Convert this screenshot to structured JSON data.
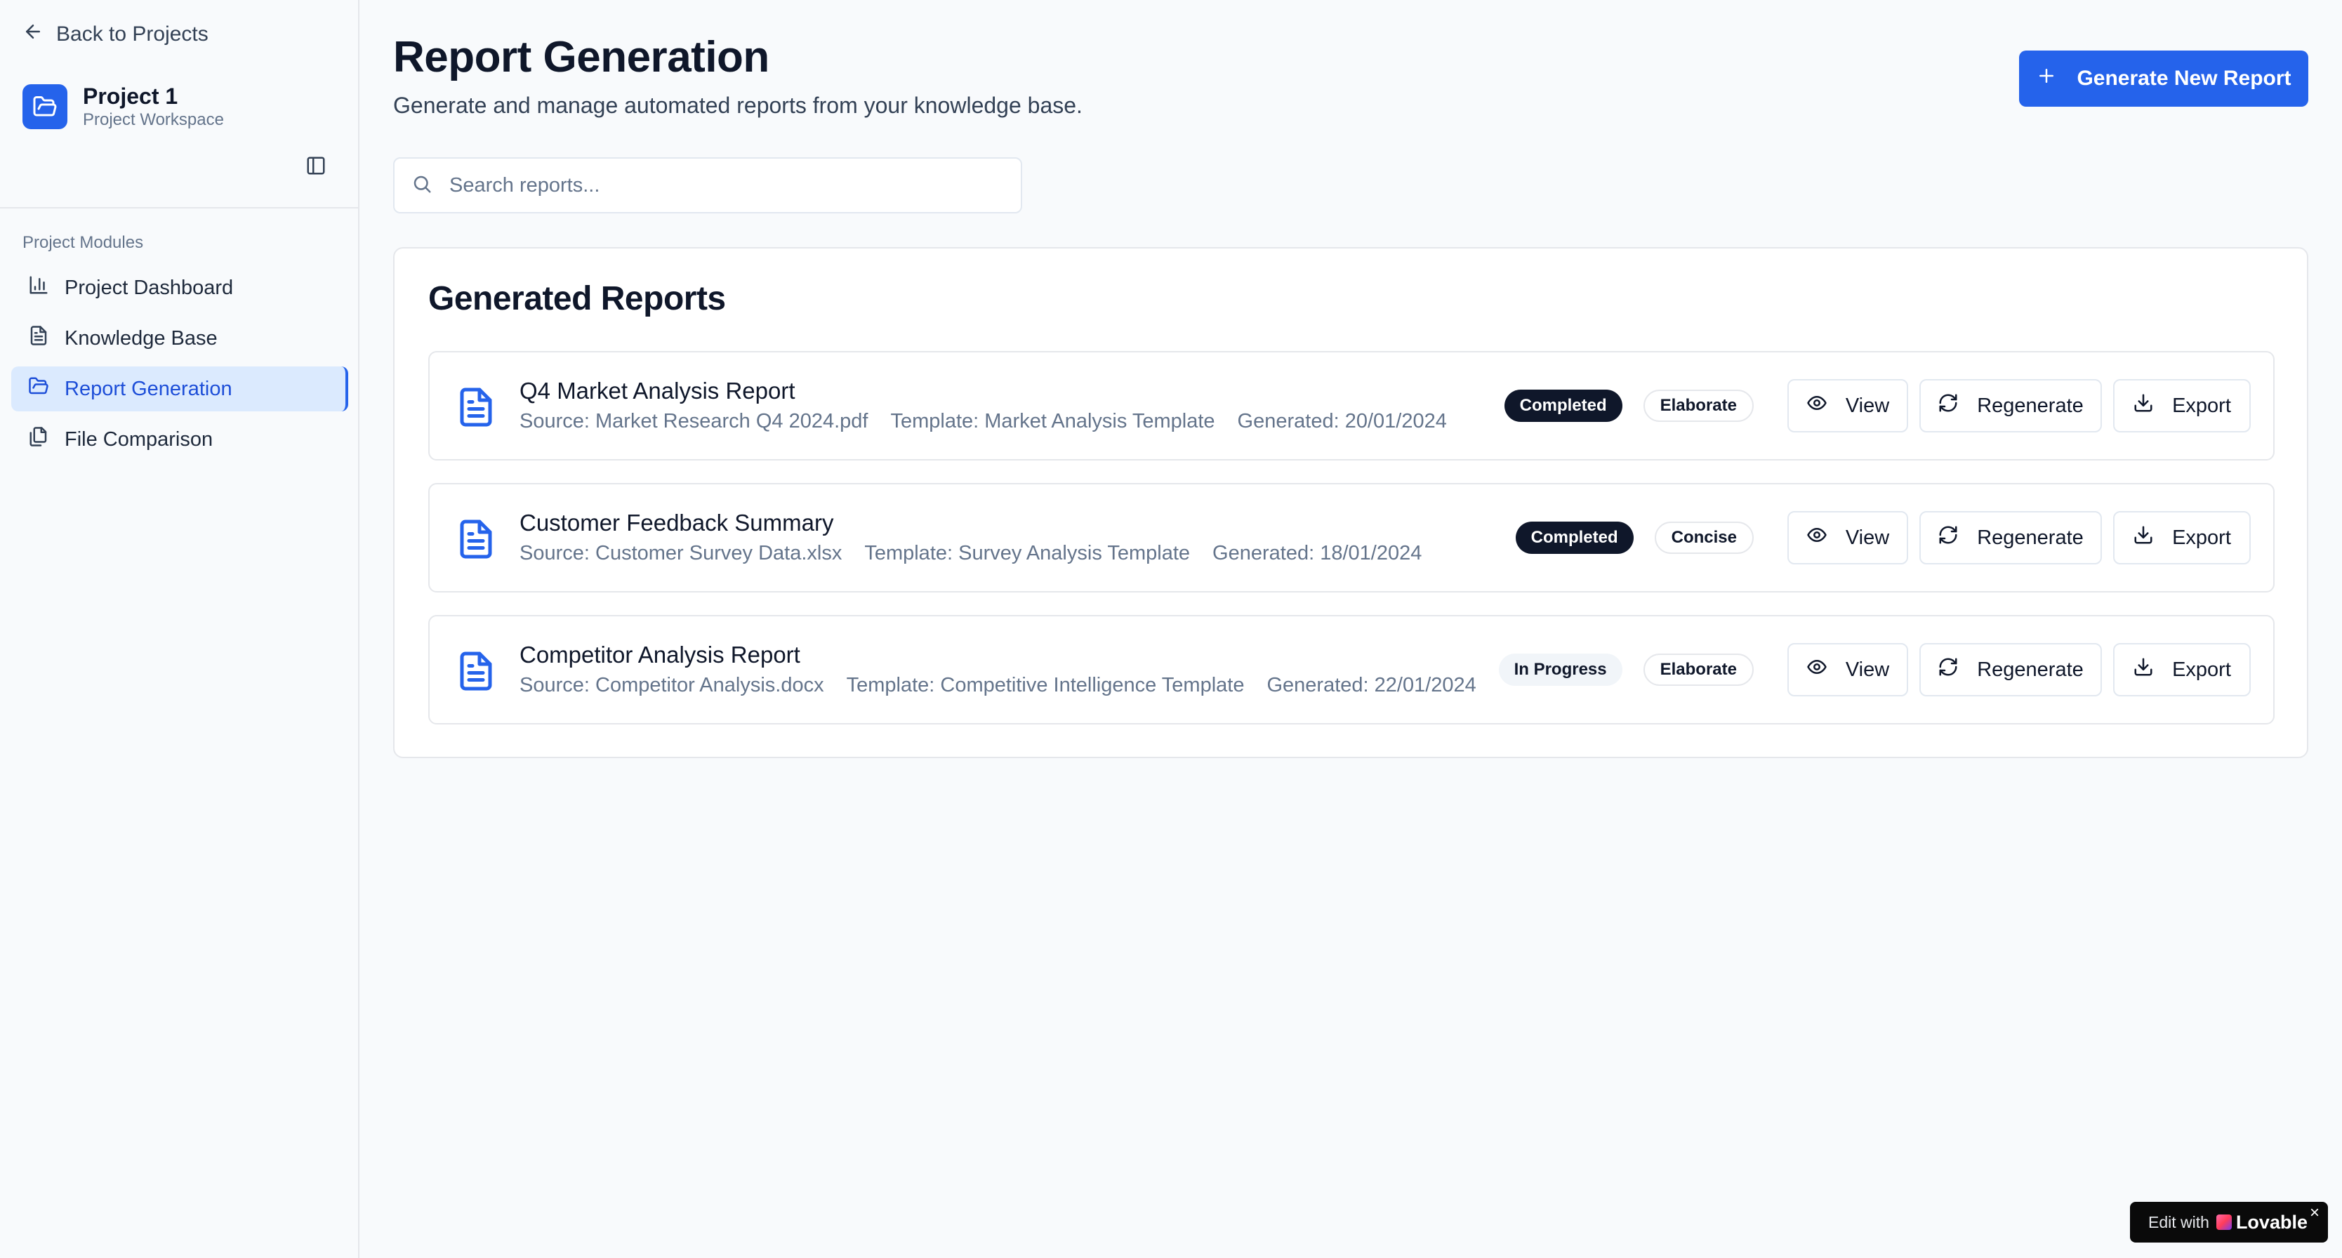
{
  "sidebar": {
    "back_label": "Back to Projects",
    "project_title": "Project 1",
    "project_subtitle": "Project Workspace",
    "modules_label": "Project Modules",
    "items": [
      {
        "label": "Project Dashboard",
        "icon": "bar-chart-icon",
        "active": false
      },
      {
        "label": "Knowledge Base",
        "icon": "file-text-icon",
        "active": false
      },
      {
        "label": "Report Generation",
        "icon": "folder-open-icon",
        "active": true
      },
      {
        "label": "File Comparison",
        "icon": "files-icon",
        "active": false
      }
    ]
  },
  "header": {
    "title": "Report Generation",
    "subtitle": "Generate and manage automated reports from your knowledge base.",
    "generate_button": "Generate New Report"
  },
  "search": {
    "placeholder": "Search reports...",
    "value": ""
  },
  "reports_card": {
    "title": "Generated Reports",
    "rows": [
      {
        "title": "Q4 Market Analysis Report",
        "source": "Source: Market Research Q4 2024.pdf",
        "template": "Template: Market Analysis Template",
        "generated": "Generated: 20/01/2024",
        "status": "Completed",
        "style": "Elaborate",
        "view": "View",
        "regenerate": "Regenerate",
        "export": "Export"
      },
      {
        "title": "Customer Feedback Summary",
        "source": "Source: Customer Survey Data.xlsx",
        "template": "Template: Survey Analysis Template",
        "generated": "Generated: 18/01/2024",
        "status": "Completed",
        "style": "Concise",
        "view": "View",
        "regenerate": "Regenerate",
        "export": "Export"
      },
      {
        "title": "Competitor Analysis Report",
        "source": "Source: Competitor Analysis.docx",
        "template": "Template: Competitive Intelligence Template",
        "generated": "Generated: 22/01/2024",
        "status": "In Progress",
        "style": "Elaborate",
        "view": "View",
        "regenerate": "Regenerate",
        "export": "Export"
      }
    ]
  },
  "lovable_badge": {
    "edit": "Edit with",
    "brand": "Lovable",
    "close": "×"
  },
  "colors": {
    "accent": "#2563eb",
    "active_nav_bg": "#dbeafe",
    "status_completed": "#0f172a"
  }
}
